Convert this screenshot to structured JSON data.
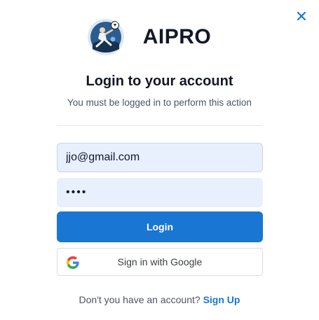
{
  "dialog": {
    "brand": "AIPRO",
    "title": "Login to your account",
    "subtitle": "You must be logged in to perform this action"
  },
  "form": {
    "email_value": "jjo@gmail.com",
    "password_value": "••••",
    "login_label": "Login",
    "google_label": "Sign in with Google"
  },
  "footer": {
    "prompt": "Don't you have an account?",
    "signup_label": "Sign Up"
  },
  "icons": {
    "close": "close-icon",
    "logo": "soccer-player-logo",
    "google": "google-logo-icon"
  },
  "colors": {
    "accent": "#1976d2",
    "field_bg": "#e8f0fe",
    "close": "#1976d2"
  }
}
